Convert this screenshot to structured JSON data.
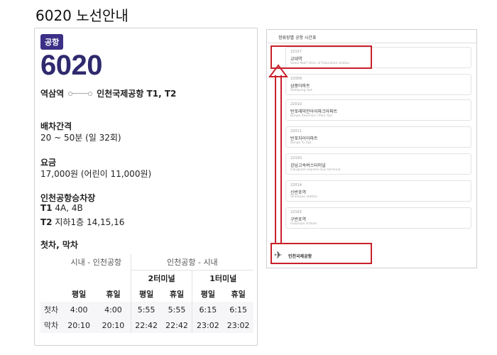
{
  "page": {
    "title": "6020 노선안내"
  },
  "route": {
    "badge": "공항",
    "number": "6020",
    "origin": "역삼역",
    "destination": "인천국제공항 T1, T2"
  },
  "interval": {
    "label": "배차간격",
    "value": "20 ~ 50분 (일 32회)"
  },
  "fare": {
    "label": "요금",
    "value": "17,000원 (어린이 11,000원)"
  },
  "boarding": {
    "label": "인천공항승차장",
    "t1_tag": "T1",
    "t1_value": "4A, 4B",
    "t2_tag": "T2",
    "t2_value": "지하1층 14,15,16"
  },
  "schedule": {
    "label": "첫차, 막차",
    "group_city": "시내 - 인천공항",
    "group_airport": "인천공항 - 시내",
    "terminal2": "2터미널",
    "terminal1": "1터미널",
    "weekday": "평일",
    "holiday": "휴일",
    "rows": [
      {
        "label": "첫차",
        "values": [
          "4:00",
          "4:00",
          "5:55",
          "5:55",
          "6:15",
          "6:15"
        ]
      },
      {
        "label": "막차",
        "values": [
          "20:10",
          "20:10",
          "22:42",
          "22:42",
          "23:02",
          "23:02"
        ]
      }
    ]
  },
  "stops_panel": {
    "title": "정류장별 공항 시간표",
    "stops": [
      {
        "code": "22157",
        "name": "교대역",
        "name_en": "Seoul Nat'l Univ. of Education station"
      },
      {
        "code": "22009",
        "name": "삼풍아파트",
        "name_en": "Sampung Apt."
      },
      {
        "code": "22010",
        "name": "반포래미안아이파크아파트",
        "name_en": "Banpo Raemian i-Park Apt."
      },
      {
        "code": "22011",
        "name": "반포자이아파트",
        "name_en": "Banpo Xi Apt."
      },
      {
        "code": "22150",
        "name": "강남고속버스터미널",
        "name_en": "Gangnam express bus terminal"
      },
      {
        "code": "22014",
        "name": "신반포역",
        "name_en": "Sinbanpo station"
      },
      {
        "code": "22163",
        "name": "구반포역",
        "name_en": "Gubanpo station"
      }
    ],
    "airport_label": "인천국제공항"
  },
  "colors": {
    "brand": "#3b2f86",
    "highlight": "#c8202b"
  }
}
